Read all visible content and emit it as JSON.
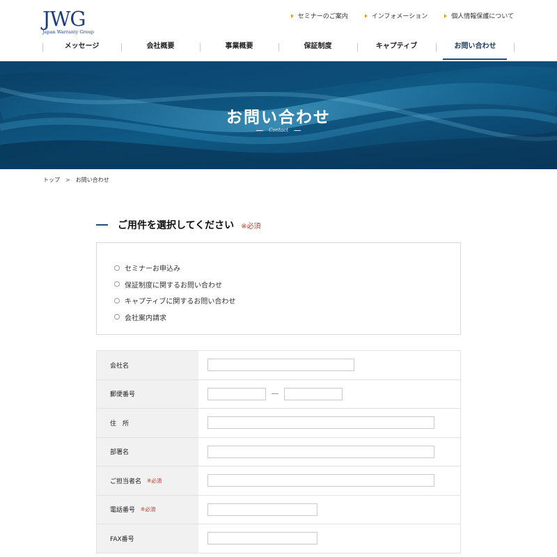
{
  "header": {
    "logo_main": "JWG",
    "logo_sub": "Japan Warranty Group",
    "util_nav": [
      "セミナーのご案内",
      "インフォメーション",
      "個人情報保護について"
    ],
    "main_nav": [
      "メッセージ",
      "会社概要",
      "事業概要",
      "保証制度",
      "キャプティブ",
      "お問い合わせ"
    ],
    "active_nav": "お問い合わせ"
  },
  "hero": {
    "title": "お問い合わせ",
    "subtitle": "Contact"
  },
  "breadcrumb": {
    "home": "トップ",
    "separator": ">",
    "current": "お問い合わせ"
  },
  "section": {
    "heading": "ご用件を選択してください",
    "required": "※必須"
  },
  "options": [
    "セミナーお申込み",
    "保証制度に関するお問い合わせ",
    "キャプティブに関するお問い合わせ",
    "会社案内請求"
  ],
  "form": {
    "required_mark": "※必須",
    "rows": [
      {
        "label": "会社名"
      },
      {
        "label": "郵便番号"
      },
      {
        "label": "住　所"
      },
      {
        "label": "部署名"
      },
      {
        "label": "ご担当者名"
      },
      {
        "label": "電話番号"
      },
      {
        "label": "FAX番号"
      }
    ]
  },
  "colors": {
    "brand_navy": "#1f3f7a",
    "accent_blue": "#1f4e79",
    "required_red": "#c0392b",
    "arrow_gold": "#d8a430"
  }
}
